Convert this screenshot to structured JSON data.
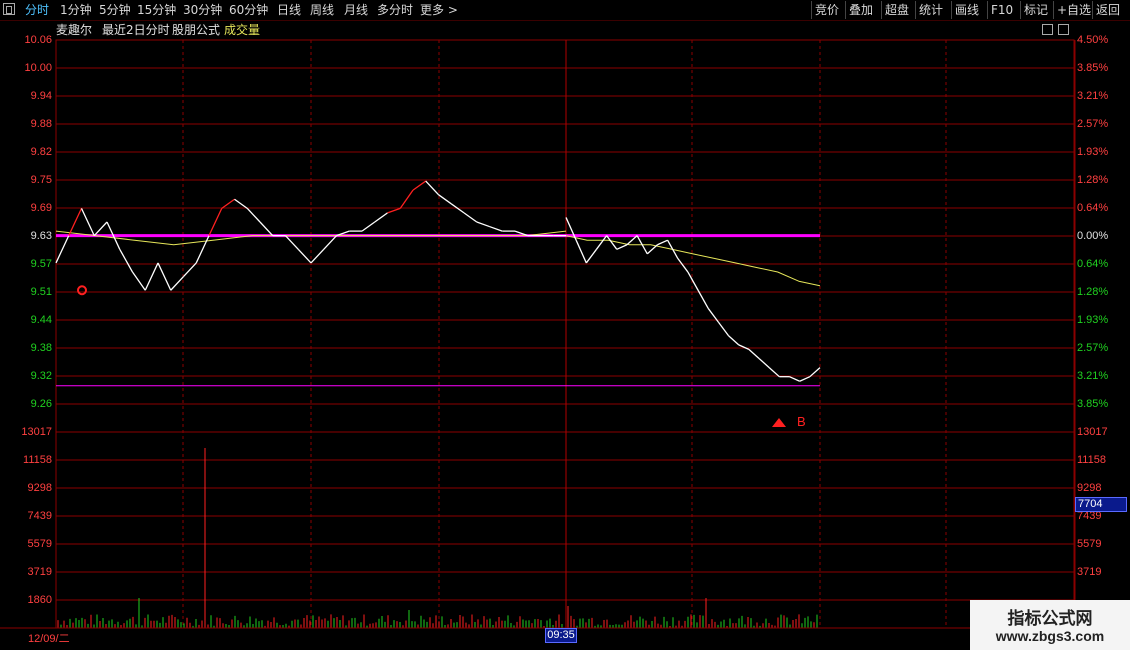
{
  "toolbar": {
    "left_items": [
      "分时",
      "1分钟",
      "5分钟",
      "15分钟",
      "30分钟",
      "60分钟",
      "日线",
      "周线",
      "月线",
      "多分时",
      "更多 >"
    ],
    "right_items": [
      "竞价",
      "叠加",
      "超盘",
      "统计",
      "画线",
      "F10",
      "标记",
      "+自选",
      "返回"
    ]
  },
  "subtitle": {
    "stock": "麦趣尔",
    "mode": "最近2日分时",
    "formula": "股朋公式",
    "volume": "成交量"
  },
  "price_axis": {
    "left_ticks": [
      "10.06",
      "10.00",
      "9.94",
      "9.88",
      "9.82",
      "9.75",
      "9.69",
      "9.63",
      "9.57",
      "9.51",
      "9.44",
      "9.38",
      "9.32",
      "9.26"
    ],
    "right_ticks": [
      "4.50%",
      "3.85%",
      "3.21%",
      "2.57%",
      "1.93%",
      "1.28%",
      "0.64%",
      "0.00%",
      "0.64%",
      "1.28%",
      "1.93%",
      "2.57%",
      "3.21%",
      "3.85%"
    ]
  },
  "volume_axis": {
    "left_ticks": [
      "13017",
      "11158",
      "9298",
      "7439",
      "5579",
      "3719",
      "1860"
    ],
    "right_ticks": [
      "13017",
      "11158",
      "9298",
      "7439",
      "5579",
      "3719"
    ],
    "current_value": "7704"
  },
  "footer": {
    "date": "12/09/二",
    "time": "09:35"
  },
  "markers": {
    "buy_label": "B"
  },
  "watermark": {
    "title": "指标公式网",
    "url": "www.zbgs3.com"
  },
  "colors": {
    "grid": "#8b0000",
    "price_line": "#ffffff",
    "rising": "#ff2020",
    "avg_line": "#e6e65a",
    "prev_close": "#ff00ff",
    "volume_up": "#ff2020",
    "volume_down": "#20d020"
  },
  "chart_data": {
    "type": "line",
    "x": "two trading days (Day 1, Day 2), 1-minute intraday",
    "ylim": [
      9.26,
      10.06
    ],
    "prev_close": 9.63,
    "price_series": {
      "day1": [
        9.57,
        9.63,
        9.69,
        9.63,
        9.66,
        9.6,
        9.55,
        9.51,
        9.57,
        9.51,
        9.54,
        9.57,
        9.63,
        9.69,
        9.71,
        9.69,
        9.66,
        9.63,
        9.63,
        9.6,
        9.57,
        9.6,
        9.63,
        9.64,
        9.64,
        9.66,
        9.68,
        9.69,
        9.73,
        9.75,
        9.72,
        9.7,
        9.68,
        9.66,
        9.65,
        9.64,
        9.64,
        9.63,
        9.63,
        9.63,
        9.63
      ],
      "day2": [
        9.67,
        9.62,
        9.57,
        9.6,
        9.63,
        9.6,
        9.61,
        9.63,
        9.59,
        9.61,
        9.62,
        9.58,
        9.55,
        9.51,
        9.47,
        9.44,
        9.41,
        9.39,
        9.38,
        9.36,
        9.34,
        9.32,
        9.32,
        9.31,
        9.32,
        9.34
      ]
    },
    "avg_series": {
      "day1": [
        9.64,
        9.63,
        9.62,
        9.61,
        9.62,
        9.63,
        9.63,
        9.63,
        9.63,
        9.63,
        9.63,
        9.63,
        9.63,
        9.64
      ],
      "day2": [
        9.63,
        9.62,
        9.62,
        9.61,
        9.61,
        9.6,
        9.59,
        9.58,
        9.57,
        9.56,
        9.55,
        9.53,
        9.52
      ]
    },
    "support_line": 9.3,
    "buy_marker_price": 9.28
  }
}
